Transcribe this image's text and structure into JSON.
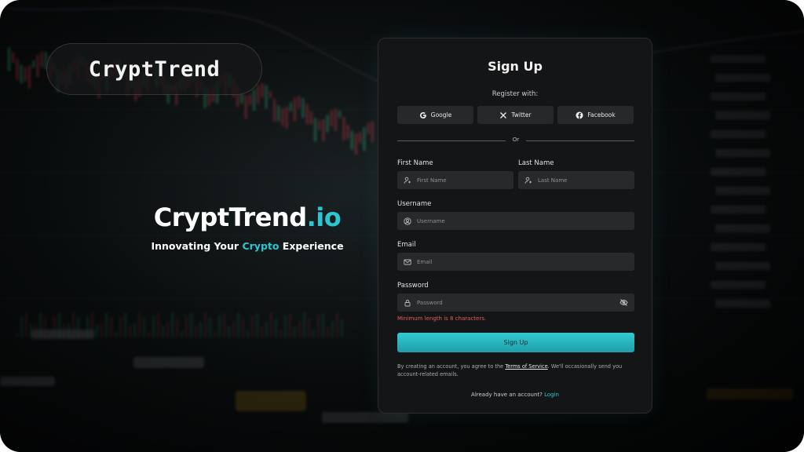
{
  "brand": {
    "pill_logo": "CryptTrend",
    "name_main": "CryptTrend",
    "name_tld": ".io",
    "tagline_start": "Innovating Your ",
    "tagline_accent": "Crypto",
    "tagline_end": " Experience",
    "accent_color": "#2ec5d2"
  },
  "form": {
    "title": "Sign Up",
    "register_with": "Register with:",
    "social": [
      {
        "label": "Google",
        "icon": "google-icon"
      },
      {
        "label": "Twitter",
        "icon": "x-icon"
      },
      {
        "label": "Facebook",
        "icon": "facebook-icon"
      }
    ],
    "divider_text": "Or",
    "first_name": {
      "label": "First Name",
      "placeholder": "First Name",
      "value": ""
    },
    "last_name": {
      "label": "Last Name",
      "placeholder": "Last Name",
      "value": ""
    },
    "username": {
      "label": "Username",
      "placeholder": "Username",
      "value": ""
    },
    "email": {
      "label": "Email",
      "placeholder": "Email",
      "value": ""
    },
    "password": {
      "label": "Password",
      "placeholder": "Password",
      "value": ""
    },
    "password_error": "Minimum length is 8 characters.",
    "submit_label": "Sign Up",
    "terms_start": "By creating an account, you agree to the ",
    "terms_link": "Terms of Service",
    "terms_end": ".  We'll occasionally send you account-related emails.",
    "login_prompt": "Already have an account? ",
    "login_link": "Login"
  },
  "colors": {
    "card_bg": "#141516",
    "input_bg": "#28292b",
    "button_gradient_top": "#35c9d3",
    "button_gradient_bottom": "#1f9ea8",
    "error": "#e0615f"
  }
}
